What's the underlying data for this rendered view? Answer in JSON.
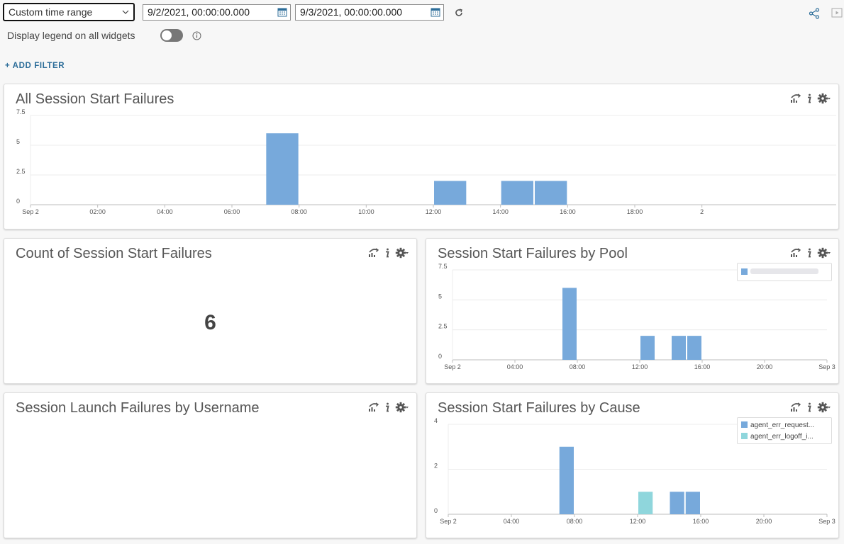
{
  "toolbar": {
    "time_range": "Custom time range",
    "start_date": "9/2/2021, 00:00:00.000",
    "end_date": "9/3/2021, 00:00:00.000",
    "legend_label": "Display legend on all widgets",
    "legend_toggle_on": false,
    "add_filter": "+ ADD FILTER"
  },
  "colors": {
    "bar_blue": "#77a9db",
    "bar_teal": "#8fd6dc",
    "accent": "#2c6d99"
  },
  "widgets": {
    "all_failures": {
      "title": "All Session Start Failures"
    },
    "count": {
      "title": "Count of Session Start Failures",
      "value": "6"
    },
    "by_pool": {
      "title": "Session Start Failures by Pool"
    },
    "by_username": {
      "title": "Session Launch Failures by Username"
    },
    "by_cause": {
      "title": "Session Start Failures by Cause",
      "legend": [
        {
          "label": "agent_err_request...",
          "color": "#77a9db"
        },
        {
          "label": "agent_err_logoff_i...",
          "color": "#8fd6dc"
        }
      ]
    }
  },
  "chart_data": [
    {
      "type": "bar",
      "title": "All Session Start Failures",
      "x_range_hours": [
        0,
        24
      ],
      "ylim": [
        0,
        7.5
      ],
      "yticks": [
        "0",
        "2.5",
        "5",
        "7.5"
      ],
      "xticks": [
        {
          "h": 0,
          "label": "Sep 2"
        },
        {
          "h": 2,
          "label": "02:00"
        },
        {
          "h": 4,
          "label": "04:00"
        },
        {
          "h": 6,
          "label": "06:00"
        },
        {
          "h": 8,
          "label": "08:00"
        },
        {
          "h": 10,
          "label": "10:00"
        },
        {
          "h": 12,
          "label": "12:00"
        },
        {
          "h": 14,
          "label": "14:00"
        },
        {
          "h": 16,
          "label": "16:00"
        },
        {
          "h": 18,
          "label": "18:00"
        },
        {
          "h": 20,
          "label": "2"
        }
      ],
      "series": [
        {
          "color": "#77a9db",
          "bars": [
            {
              "start": "07:00",
              "end": "08:00",
              "value": 6
            },
            {
              "start": "12:00",
              "end": "13:00",
              "value": 2
            },
            {
              "start": "14:00",
              "end": "15:00",
              "value": 2
            },
            {
              "start": "15:00",
              "end": "16:00",
              "value": 2
            }
          ]
        }
      ]
    },
    {
      "type": "bar",
      "title": "Session Start Failures by Pool",
      "x_range_hours": [
        0,
        24
      ],
      "ylim": [
        0,
        7.5
      ],
      "yticks": [
        "0",
        "2.5",
        "5",
        "7.5"
      ],
      "xticks": [
        {
          "h": 0,
          "label": "Sep 2"
        },
        {
          "h": 4,
          "label": "04:00"
        },
        {
          "h": 8,
          "label": "08:00"
        },
        {
          "h": 12,
          "label": "12:00"
        },
        {
          "h": 16,
          "label": "16:00"
        },
        {
          "h": 20,
          "label": "20:00"
        },
        {
          "h": 24,
          "label": "Sep 3"
        }
      ],
      "series": [
        {
          "color": "#77a9db",
          "bars": [
            {
              "start": "07:00",
              "end": "08:00",
              "value": 6
            },
            {
              "start": "12:00",
              "end": "13:00",
              "value": 2
            },
            {
              "start": "14:00",
              "end": "15:00",
              "value": 2
            },
            {
              "start": "15:00",
              "end": "16:00",
              "value": 2
            }
          ]
        }
      ]
    },
    {
      "type": "bar",
      "title": "Session Start Failures by Cause",
      "x_range_hours": [
        0,
        24
      ],
      "ylim": [
        0,
        4
      ],
      "yticks": [
        "0",
        "2",
        "4"
      ],
      "xticks": [
        {
          "h": 0,
          "label": "Sep 2"
        },
        {
          "h": 4,
          "label": "04:00"
        },
        {
          "h": 8,
          "label": "08:00"
        },
        {
          "h": 12,
          "label": "12:00"
        },
        {
          "h": 16,
          "label": "16:00"
        },
        {
          "h": 20,
          "label": "20:00"
        },
        {
          "h": 24,
          "label": "Sep 3"
        }
      ],
      "series": [
        {
          "name": "agent_err_request...",
          "color": "#77a9db",
          "bars": [
            {
              "start": "07:00",
              "end": "08:00",
              "value": 3
            },
            {
              "start": "14:00",
              "end": "15:00",
              "value": 1
            },
            {
              "start": "15:00",
              "end": "16:00",
              "value": 1
            }
          ]
        },
        {
          "name": "agent_err_logoff_i...",
          "color": "#8fd6dc",
          "bars": [
            {
              "start": "12:00",
              "end": "13:00",
              "value": 1
            }
          ]
        }
      ]
    }
  ]
}
